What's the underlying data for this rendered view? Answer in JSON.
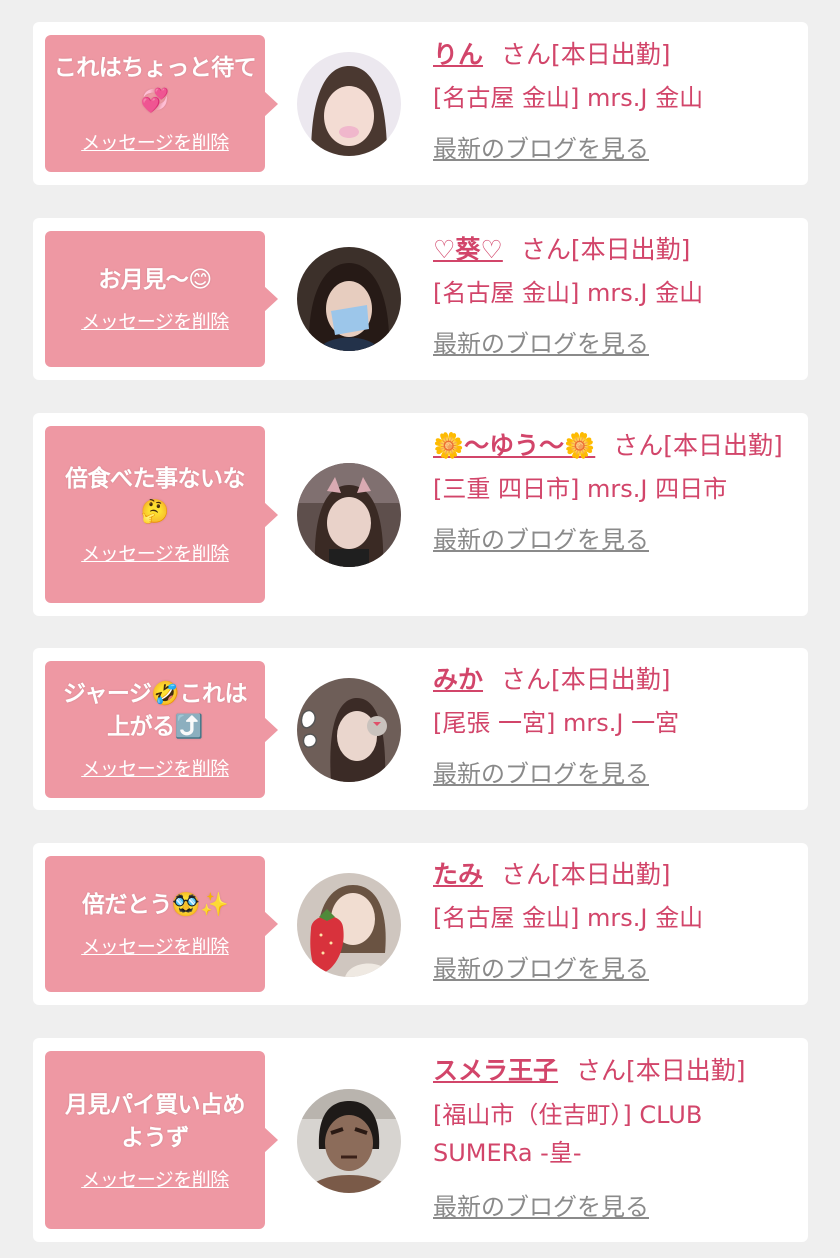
{
  "ui": {
    "delete_label": "メッセージを削除",
    "blog_label": "最新のブログを見る"
  },
  "items": [
    {
      "message": "これはちょっと待て💞",
      "name": "りん",
      "suffix": "さん[本日出勤]",
      "shop": "[名古屋 金山] mrs.J 金山"
    },
    {
      "message": "お月見〜😊",
      "name": "♡葵♡",
      "suffix": "さん[本日出勤]",
      "shop": "[名古屋 金山] mrs.J 金山"
    },
    {
      "message": "倍食べた事ないな🤔",
      "name": "🌼〜ゆう〜🌼",
      "suffix": "さん[本日出勤]",
      "shop": "[三重 四日市] mrs.J 四日市"
    },
    {
      "message": "ジャージ🤣これは上がる⤴️",
      "name": "みか",
      "suffix": "さん[本日出勤]",
      "shop": "[尾張 一宮] mrs.J 一宮"
    },
    {
      "message": "倍だとう🥸✨",
      "name": "たみ",
      "suffix": "さん[本日出勤]",
      "shop": "[名古屋 金山] mrs.J 金山"
    },
    {
      "message": "月見パイ買い占めようず",
      "name": "スメラ王子",
      "suffix": "さん[本日出勤]",
      "shop": "[福山市（住吉町）] CLUB SUMERa -皇-"
    }
  ]
}
